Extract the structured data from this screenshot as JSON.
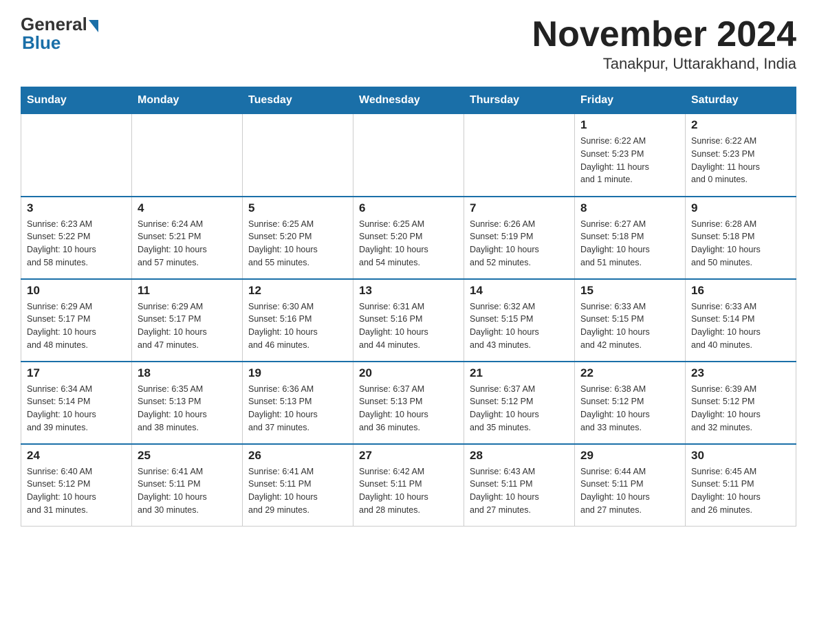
{
  "header": {
    "logo_general": "General",
    "logo_blue": "Blue",
    "month_title": "November 2024",
    "location": "Tanakpur, Uttarakhand, India"
  },
  "weekdays": [
    "Sunday",
    "Monday",
    "Tuesday",
    "Wednesday",
    "Thursday",
    "Friday",
    "Saturday"
  ],
  "weeks": [
    [
      {
        "day": "",
        "info": ""
      },
      {
        "day": "",
        "info": ""
      },
      {
        "day": "",
        "info": ""
      },
      {
        "day": "",
        "info": ""
      },
      {
        "day": "",
        "info": ""
      },
      {
        "day": "1",
        "info": "Sunrise: 6:22 AM\nSunset: 5:23 PM\nDaylight: 11 hours\nand 1 minute."
      },
      {
        "day": "2",
        "info": "Sunrise: 6:22 AM\nSunset: 5:23 PM\nDaylight: 11 hours\nand 0 minutes."
      }
    ],
    [
      {
        "day": "3",
        "info": "Sunrise: 6:23 AM\nSunset: 5:22 PM\nDaylight: 10 hours\nand 58 minutes."
      },
      {
        "day": "4",
        "info": "Sunrise: 6:24 AM\nSunset: 5:21 PM\nDaylight: 10 hours\nand 57 minutes."
      },
      {
        "day": "5",
        "info": "Sunrise: 6:25 AM\nSunset: 5:20 PM\nDaylight: 10 hours\nand 55 minutes."
      },
      {
        "day": "6",
        "info": "Sunrise: 6:25 AM\nSunset: 5:20 PM\nDaylight: 10 hours\nand 54 minutes."
      },
      {
        "day": "7",
        "info": "Sunrise: 6:26 AM\nSunset: 5:19 PM\nDaylight: 10 hours\nand 52 minutes."
      },
      {
        "day": "8",
        "info": "Sunrise: 6:27 AM\nSunset: 5:18 PM\nDaylight: 10 hours\nand 51 minutes."
      },
      {
        "day": "9",
        "info": "Sunrise: 6:28 AM\nSunset: 5:18 PM\nDaylight: 10 hours\nand 50 minutes."
      }
    ],
    [
      {
        "day": "10",
        "info": "Sunrise: 6:29 AM\nSunset: 5:17 PM\nDaylight: 10 hours\nand 48 minutes."
      },
      {
        "day": "11",
        "info": "Sunrise: 6:29 AM\nSunset: 5:17 PM\nDaylight: 10 hours\nand 47 minutes."
      },
      {
        "day": "12",
        "info": "Sunrise: 6:30 AM\nSunset: 5:16 PM\nDaylight: 10 hours\nand 46 minutes."
      },
      {
        "day": "13",
        "info": "Sunrise: 6:31 AM\nSunset: 5:16 PM\nDaylight: 10 hours\nand 44 minutes."
      },
      {
        "day": "14",
        "info": "Sunrise: 6:32 AM\nSunset: 5:15 PM\nDaylight: 10 hours\nand 43 minutes."
      },
      {
        "day": "15",
        "info": "Sunrise: 6:33 AM\nSunset: 5:15 PM\nDaylight: 10 hours\nand 42 minutes."
      },
      {
        "day": "16",
        "info": "Sunrise: 6:33 AM\nSunset: 5:14 PM\nDaylight: 10 hours\nand 40 minutes."
      }
    ],
    [
      {
        "day": "17",
        "info": "Sunrise: 6:34 AM\nSunset: 5:14 PM\nDaylight: 10 hours\nand 39 minutes."
      },
      {
        "day": "18",
        "info": "Sunrise: 6:35 AM\nSunset: 5:13 PM\nDaylight: 10 hours\nand 38 minutes."
      },
      {
        "day": "19",
        "info": "Sunrise: 6:36 AM\nSunset: 5:13 PM\nDaylight: 10 hours\nand 37 minutes."
      },
      {
        "day": "20",
        "info": "Sunrise: 6:37 AM\nSunset: 5:13 PM\nDaylight: 10 hours\nand 36 minutes."
      },
      {
        "day": "21",
        "info": "Sunrise: 6:37 AM\nSunset: 5:12 PM\nDaylight: 10 hours\nand 35 minutes."
      },
      {
        "day": "22",
        "info": "Sunrise: 6:38 AM\nSunset: 5:12 PM\nDaylight: 10 hours\nand 33 minutes."
      },
      {
        "day": "23",
        "info": "Sunrise: 6:39 AM\nSunset: 5:12 PM\nDaylight: 10 hours\nand 32 minutes."
      }
    ],
    [
      {
        "day": "24",
        "info": "Sunrise: 6:40 AM\nSunset: 5:12 PM\nDaylight: 10 hours\nand 31 minutes."
      },
      {
        "day": "25",
        "info": "Sunrise: 6:41 AM\nSunset: 5:11 PM\nDaylight: 10 hours\nand 30 minutes."
      },
      {
        "day": "26",
        "info": "Sunrise: 6:41 AM\nSunset: 5:11 PM\nDaylight: 10 hours\nand 29 minutes."
      },
      {
        "day": "27",
        "info": "Sunrise: 6:42 AM\nSunset: 5:11 PM\nDaylight: 10 hours\nand 28 minutes."
      },
      {
        "day": "28",
        "info": "Sunrise: 6:43 AM\nSunset: 5:11 PM\nDaylight: 10 hours\nand 27 minutes."
      },
      {
        "day": "29",
        "info": "Sunrise: 6:44 AM\nSunset: 5:11 PM\nDaylight: 10 hours\nand 27 minutes."
      },
      {
        "day": "30",
        "info": "Sunrise: 6:45 AM\nSunset: 5:11 PM\nDaylight: 10 hours\nand 26 minutes."
      }
    ]
  ]
}
